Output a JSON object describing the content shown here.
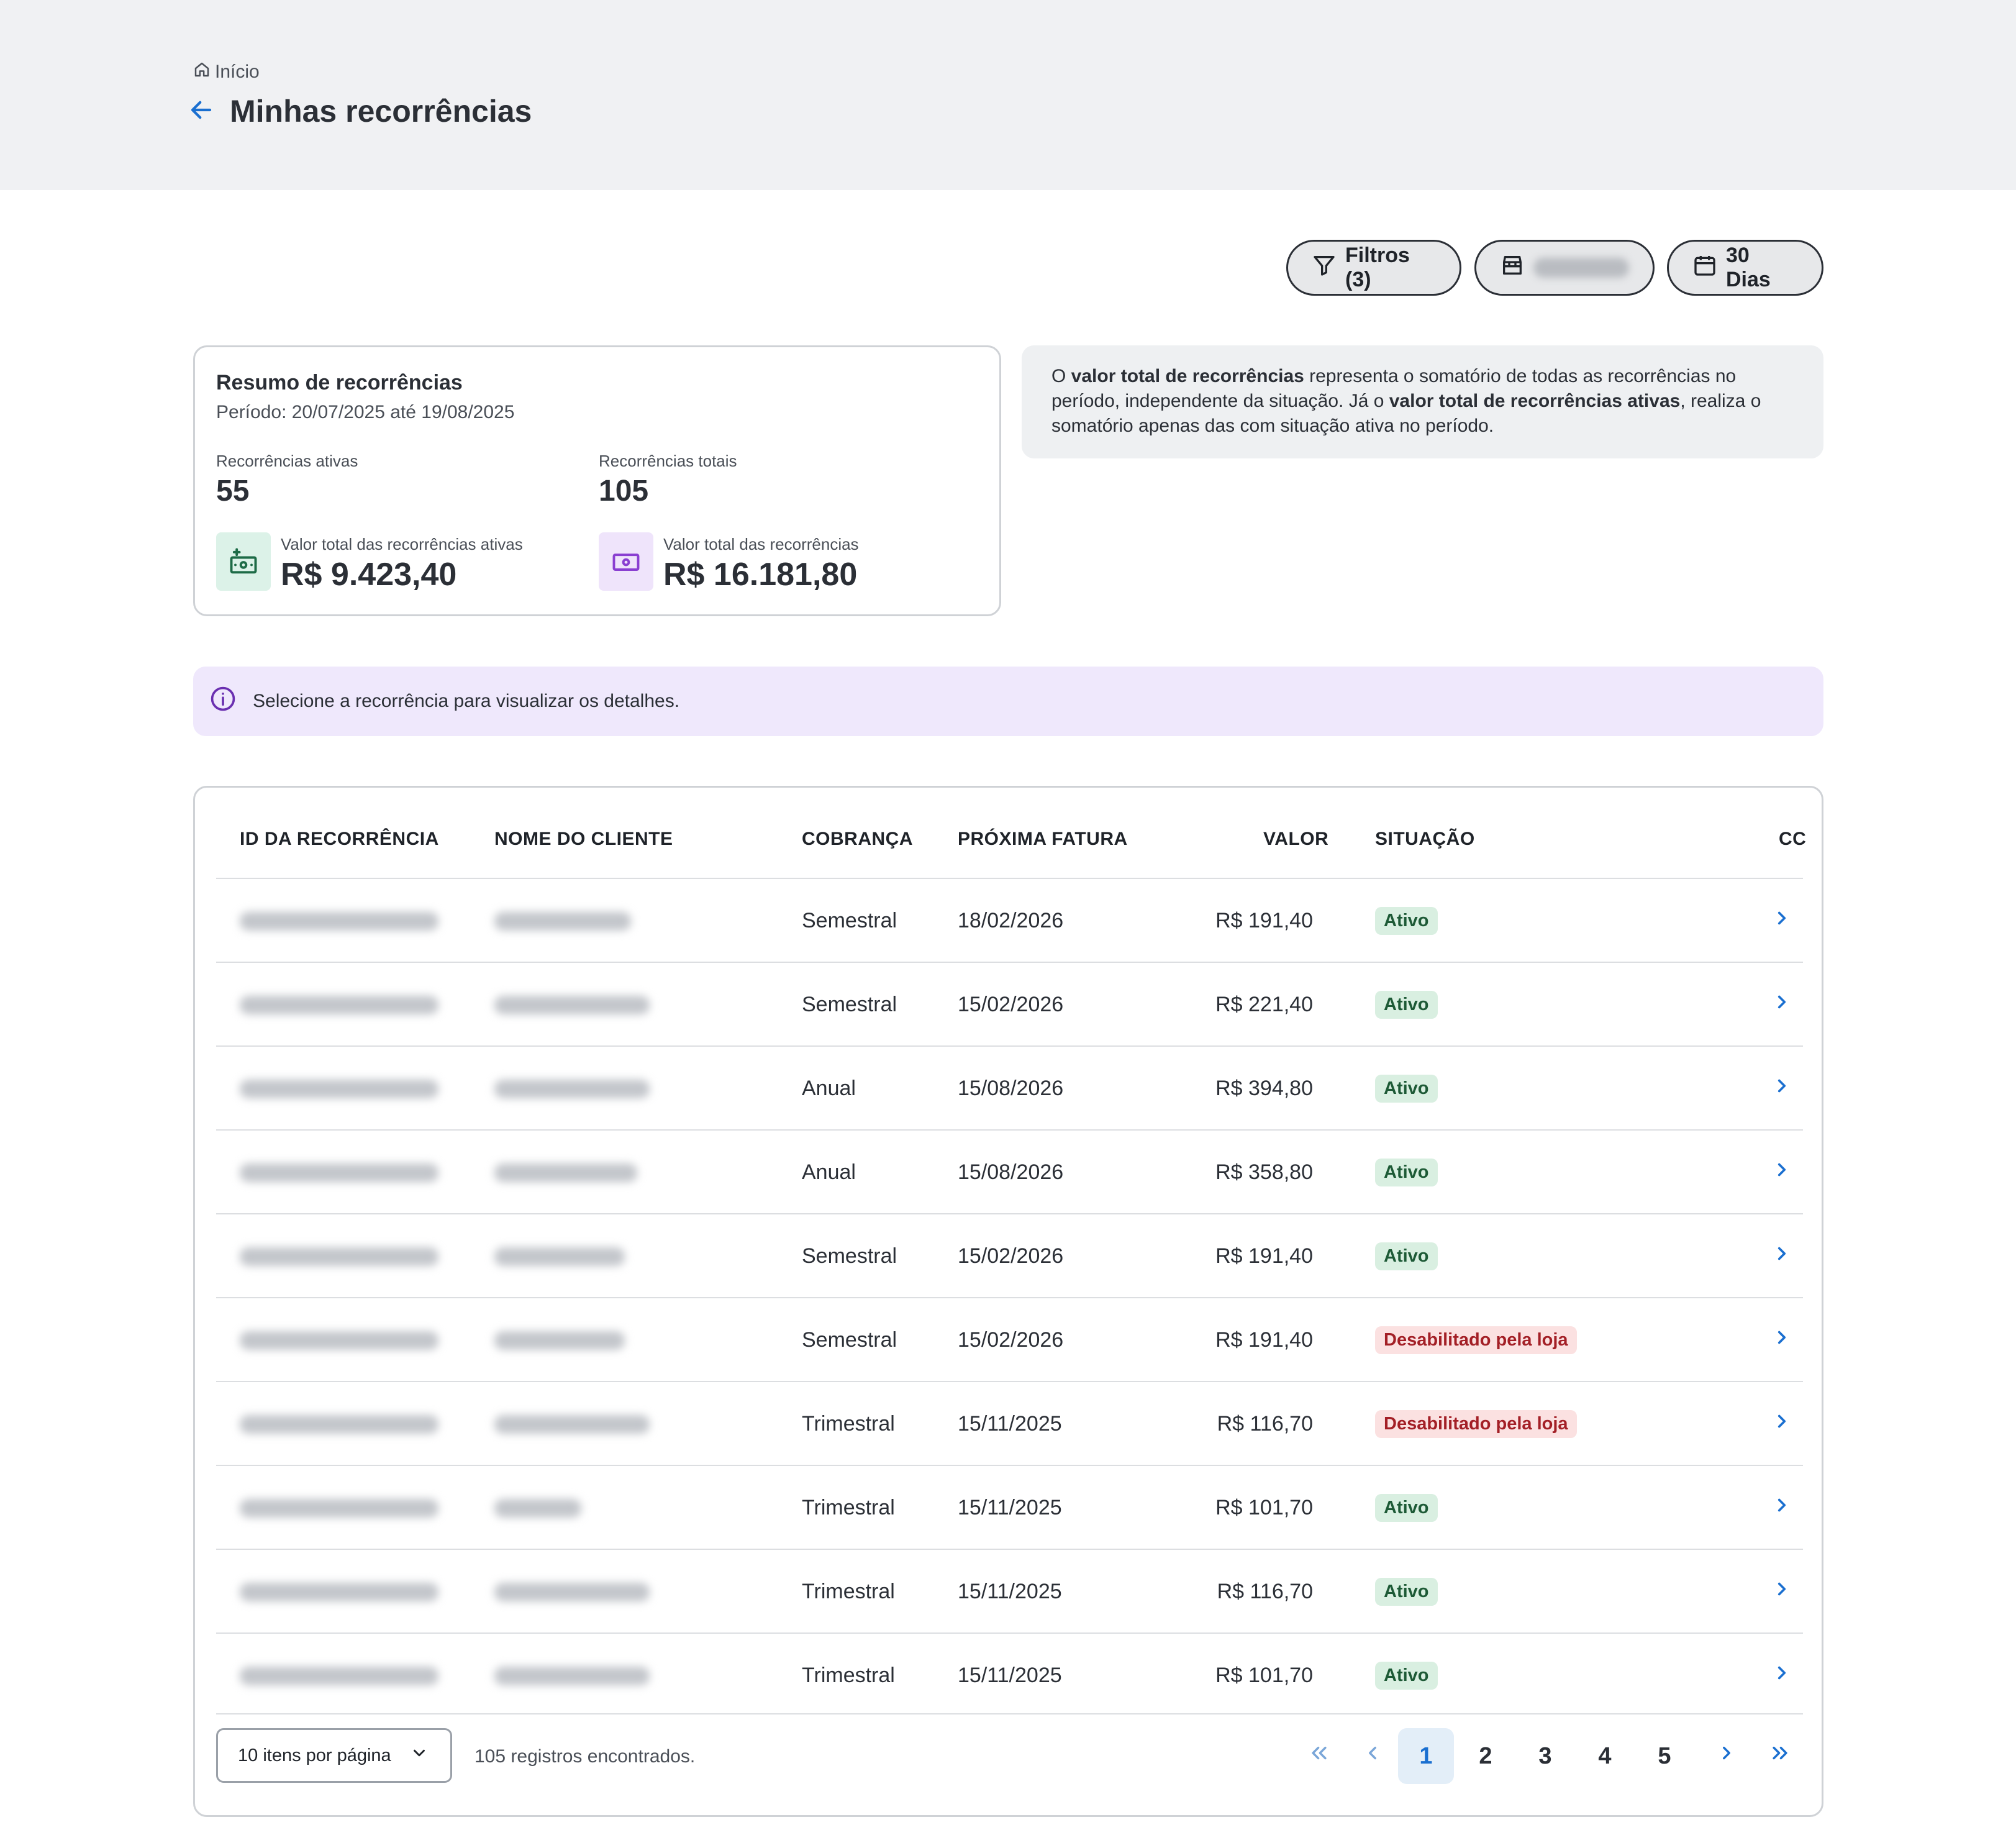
{
  "header": {
    "breadcrumb": "Início",
    "title": "Minhas recorrências"
  },
  "toolbar": {
    "filters_label": "Filtros (3)",
    "days_label": "30 Dias"
  },
  "summary": {
    "title": "Resumo de recorrências",
    "period": "Período: 20/07/2025 até 19/08/2025",
    "active_label": "Recorrências ativas",
    "active_value": "55",
    "total_label": "Recorrências totais",
    "total_value": "105",
    "active_amount_label": "Valor total das recorrências ativas",
    "active_amount_value": "R$ 9.423,40",
    "total_amount_label": "Valor total das recorrências",
    "total_amount_value": "R$ 16.181,80"
  },
  "info": {
    "p1": "O ",
    "b1": "valor total de recorrências",
    "p2": " representa o somatório de todas as recorrências no período, independente da situação. Já o ",
    "b2": "valor total de recorrências ativas",
    "p3": ", realiza o somatório apenas das com situação ativa no período."
  },
  "alert": {
    "text": "Selecione a recorrência para visualizar os detalhes."
  },
  "table": {
    "headers": {
      "id": "ID DA RECORRÊNCIA",
      "client": "NOME DO CLIENTE",
      "billing": "COBRANÇA",
      "next": "PRÓXIMA FATURA",
      "value": "VALOR",
      "status": "SITUAÇÃO",
      "cc": "CC"
    },
    "rows": [
      {
        "billing": "Semestral",
        "next": "18/02/2026",
        "value": "R$ 191,40",
        "status": "Ativo"
      },
      {
        "billing": "Semestral",
        "next": "15/02/2026",
        "value": "R$ 221,40",
        "status": "Ativo"
      },
      {
        "billing": "Anual",
        "next": "15/08/2026",
        "value": "R$ 394,80",
        "status": "Ativo"
      },
      {
        "billing": "Anual",
        "next": "15/08/2026",
        "value": "R$ 358,80",
        "status": "Ativo"
      },
      {
        "billing": "Semestral",
        "next": "15/02/2026",
        "value": "R$ 191,40",
        "status": "Ativo"
      },
      {
        "billing": "Semestral",
        "next": "15/02/2026",
        "value": "R$ 191,40",
        "status": "Desabilitado pela loja"
      },
      {
        "billing": "Trimestral",
        "next": "15/11/2025",
        "value": "R$ 116,70",
        "status": "Desabilitado pela loja"
      },
      {
        "billing": "Trimestral",
        "next": "15/11/2025",
        "value": "R$ 101,70",
        "status": "Ativo"
      },
      {
        "billing": "Trimestral",
        "next": "15/11/2025",
        "value": "R$ 116,70",
        "status": "Ativo"
      },
      {
        "billing": "Trimestral",
        "next": "15/11/2025",
        "value": "R$ 101,70",
        "status": "Ativo"
      }
    ]
  },
  "pagination": {
    "per_page": "10 itens por página",
    "records": "105 registros encontrados.",
    "pages": [
      "1",
      "2",
      "3",
      "4",
      "5"
    ],
    "current": "1"
  },
  "icons": {
    "breadcrumb": "home-icon",
    "back": "arrow-left-icon",
    "filters": "filter-icon",
    "store": "store-icon",
    "days": "calendar-icon",
    "active_amount": "cash-add-icon",
    "total_amount": "cash-icon",
    "alert": "info-icon",
    "row": "chevron-right-icon"
  },
  "colors": {
    "accent": "#1a6fd0",
    "active_badge_bg": "#d9efe1",
    "active_badge_text": "#1d5a36",
    "disabled_badge_bg": "#fbe1e1",
    "disabled_badge_text": "#a31f26",
    "alert_bg": "#efe8fc",
    "green_icon_bg": "#dcf2e8",
    "purple_icon_bg": "#efe4fb"
  }
}
